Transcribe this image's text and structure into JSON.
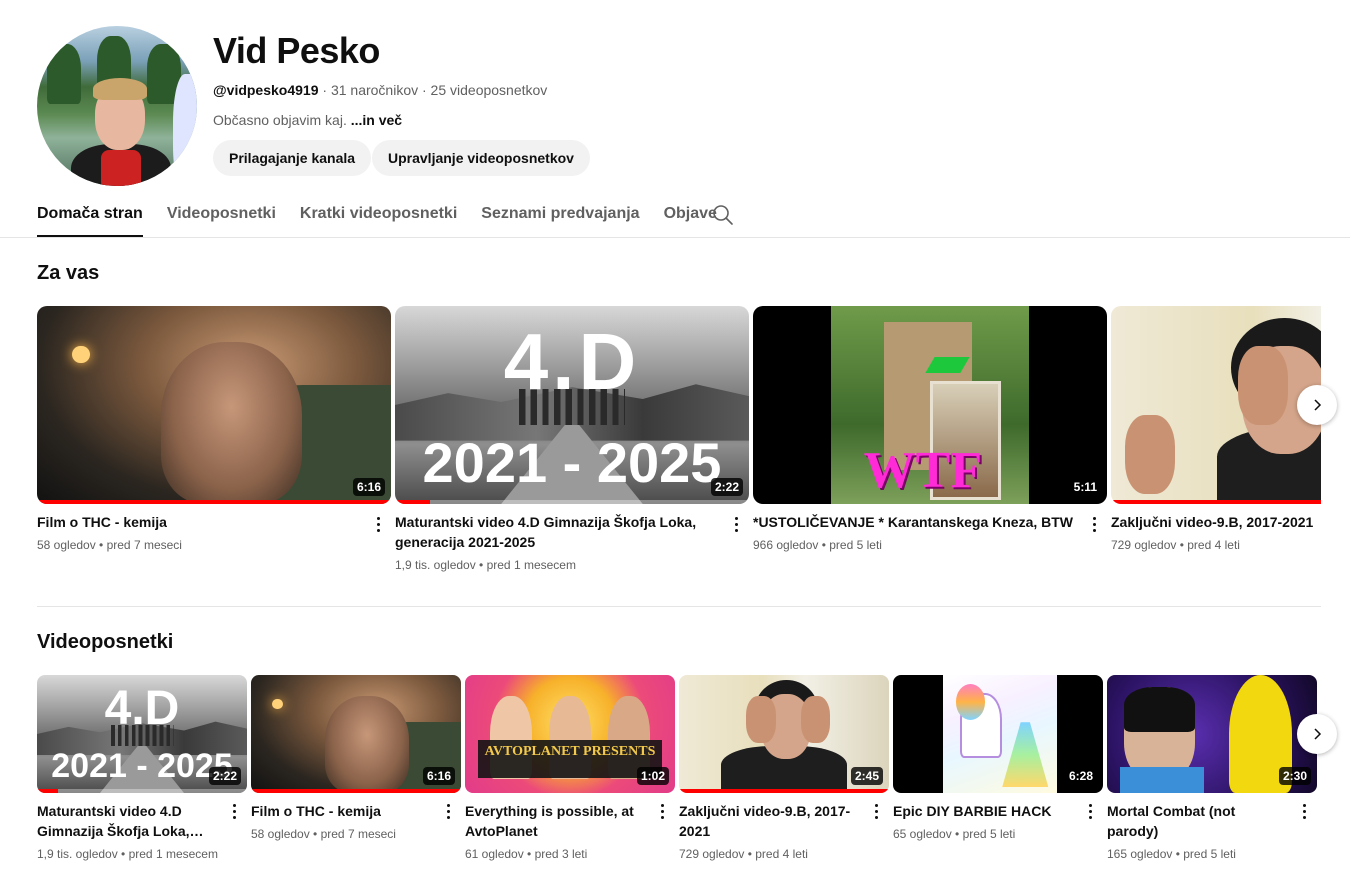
{
  "channel": {
    "name": "Vid Pesko",
    "handle": "@vidpesko4919",
    "subscribers": " · 31 naročnikov",
    "videos": " · 25 videoposnetkov",
    "description": "Občasno objavim kaj.",
    "more": " ...in več",
    "customize_label": "Prilagajanje kanala",
    "manage_label": "Upravljanje videoposnetkov"
  },
  "tabs": [
    {
      "label": "Domača stran",
      "active": true
    },
    {
      "label": "Videoposnetki"
    },
    {
      "label": "Kratki videoposnetki"
    },
    {
      "label": "Seznami predvajanja"
    },
    {
      "label": "Objave"
    }
  ],
  "for_you": {
    "title": "Za vas",
    "videos": [
      {
        "title": "Film o THC - kemija",
        "stats": "58 ogledov • pred 7 meseci",
        "duration": "6:16",
        "progress": 1.0,
        "icon": "thumbnail-thc"
      },
      {
        "title": "Maturantski video 4.D Gimnazija Škofja Loka, generacija 2021-2025",
        "stats": "1,9 tis. ogledov • pred 1 mesecem",
        "duration": "2:22",
        "progress": 0.1,
        "overlay_top": "4.D",
        "overlay_bottom": "2021 - 2025",
        "icon": "thumbnail-4d"
      },
      {
        "title": "*USTOLIČEVANJE * Karantanskega Kneza, BTW",
        "stats": "966 ogledov • pred 5 leti",
        "duration": "5:11",
        "progress": 0,
        "overlay": "WTF",
        "icon": "thumbnail-wtf"
      },
      {
        "title": "Zaključni video-9.B, 2017-2021",
        "stats": "729 ogledov • pred 4 leti",
        "duration": "",
        "progress": 1.0,
        "icon": "thumbnail-zakljucni"
      }
    ]
  },
  "videos_section": {
    "title": "Videoposnetki",
    "videos": [
      {
        "title": "Maturantski video 4.D Gimnazija Škofja Loka,…",
        "stats": "1,9 tis. ogledov • pred 1 mesecem",
        "duration": "2:22",
        "progress": 0.1,
        "overlay_top": "4.D",
        "overlay_bottom": "2021 - 2025"
      },
      {
        "title": "Film o THC - kemija",
        "stats": "58 ogledov • pred 7 meseci",
        "duration": "6:16",
        "progress": 1.0
      },
      {
        "title": "Everything is possible, at AvtoPlanet",
        "stats": "61 ogledov • pred 3 leti",
        "duration": "1:02",
        "progress": 0,
        "overlay": "AVTOPLANET PRESENTS"
      },
      {
        "title": "Zaključni video-9.B, 2017-2021",
        "stats": "729 ogledov • pred 4 leti",
        "duration": "2:45",
        "progress": 1.0
      },
      {
        "title": "Epic DIY BARBIE HACK",
        "stats": "65 ogledov • pred 5 leti",
        "duration": "6:28",
        "progress": 0
      },
      {
        "title": "Mortal Combat (not parody)",
        "stats": "165 ogledov • pred 5 leti",
        "duration": "2:30",
        "progress": 0
      }
    ]
  },
  "colors": {
    "progress": "#ff0000",
    "chip_bg": "#f2f2f2",
    "secondary_text": "#606060"
  }
}
